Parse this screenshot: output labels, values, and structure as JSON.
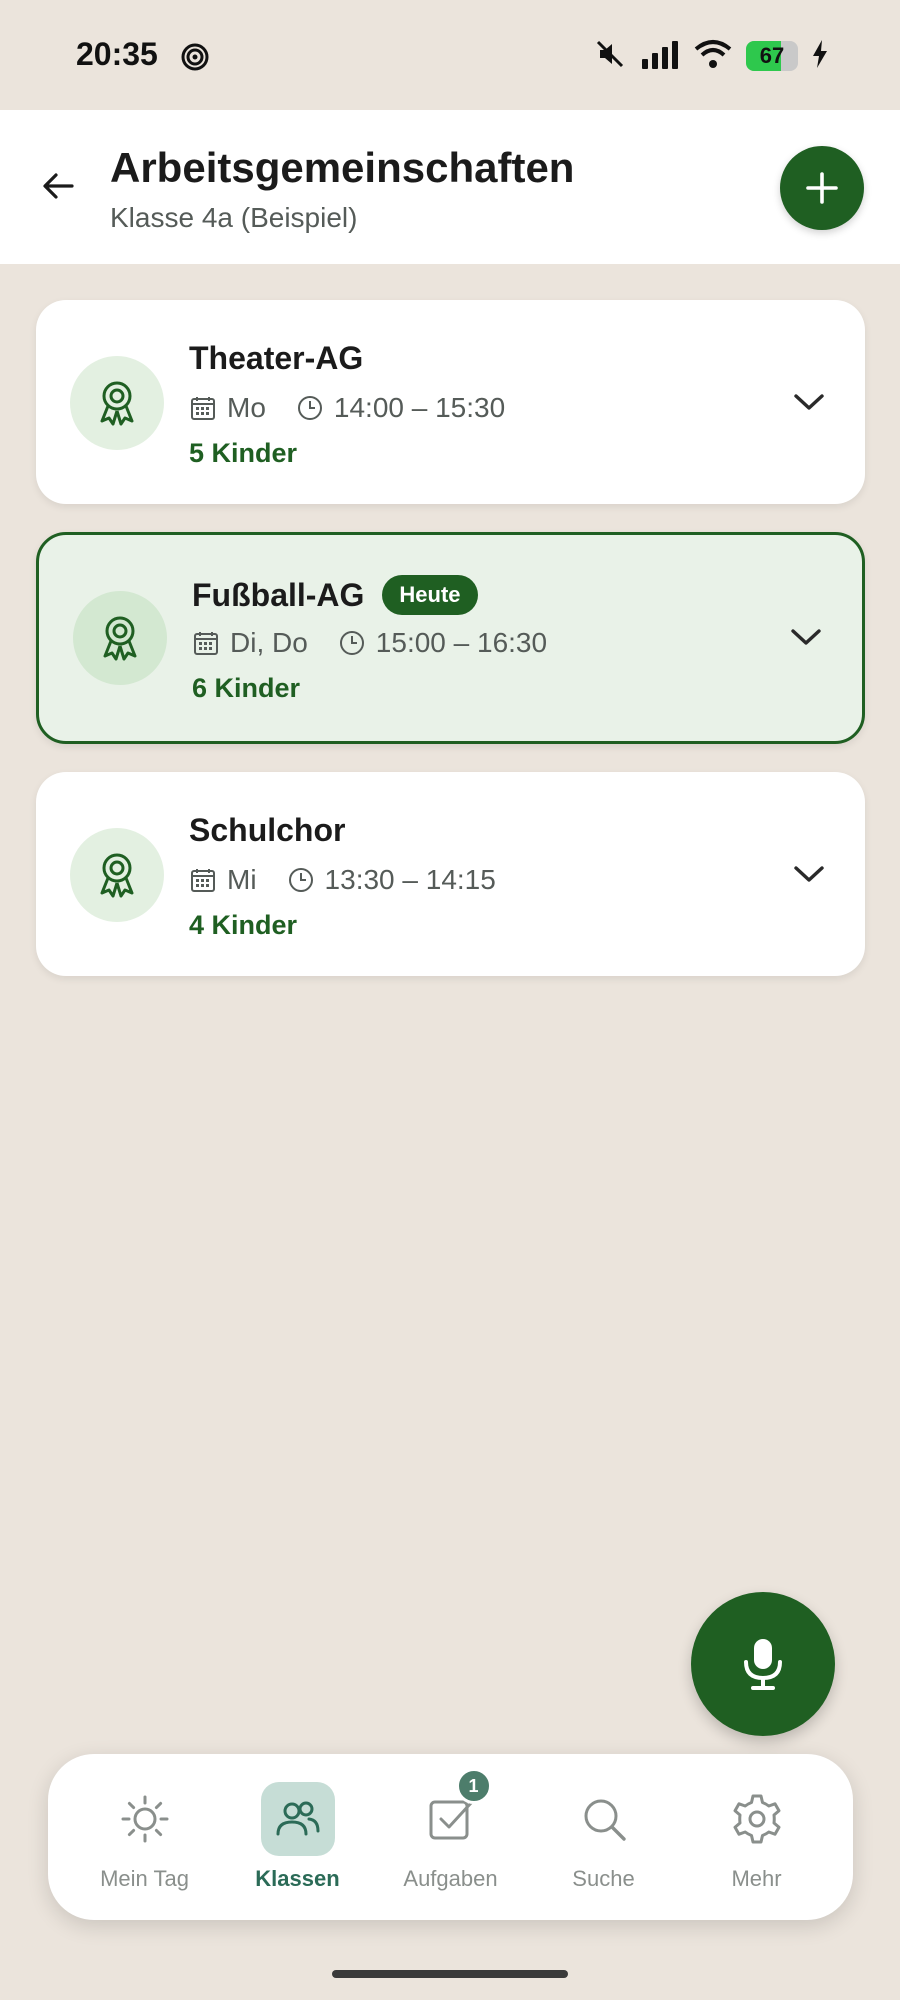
{
  "status_bar": {
    "time": "20:35",
    "battery_level": "67",
    "icons": [
      "swirl-notification-icon",
      "mute-icon",
      "cell-signal-icon",
      "wifi-icon",
      "battery-icon",
      "charging-icon"
    ]
  },
  "header": {
    "title": "Arbeitsgemeinschaften",
    "subtitle": "Klasse 4a (Beispiel)",
    "icons": [
      "back-arrow-icon",
      "plus-icon"
    ]
  },
  "colors": {
    "background": "#ebe4dc",
    "primary": "#1f5f22",
    "card_highlight": "#e9f2e8",
    "nav_active": "#c6ddd6"
  },
  "groups": [
    {
      "title": "Theater-AG",
      "badge": "",
      "days": "Mo",
      "time": "14:00 – 15:30",
      "count": "5 Kinder",
      "highlighted": false
    },
    {
      "title": "Fußball-AG",
      "badge": "Heute",
      "days": "Di, Do",
      "time": "15:00 – 16:30",
      "count": "6 Kinder",
      "highlighted": true
    },
    {
      "title": "Schulchor",
      "badge": "",
      "days": "Mi",
      "time": "13:30 – 14:15",
      "count": "4 Kinder",
      "highlighted": false
    }
  ],
  "nav": {
    "items": [
      {
        "label": "Mein Tag",
        "icon": "sun-icon",
        "active": false
      },
      {
        "label": "Klassen",
        "icon": "people-icon",
        "active": true
      },
      {
        "label": "Aufgaben",
        "icon": "checkbox-icon",
        "active": false,
        "badge": "1"
      },
      {
        "label": "Suche",
        "icon": "search-icon",
        "active": false
      },
      {
        "label": "Mehr",
        "icon": "gear-icon",
        "active": false
      }
    ]
  }
}
